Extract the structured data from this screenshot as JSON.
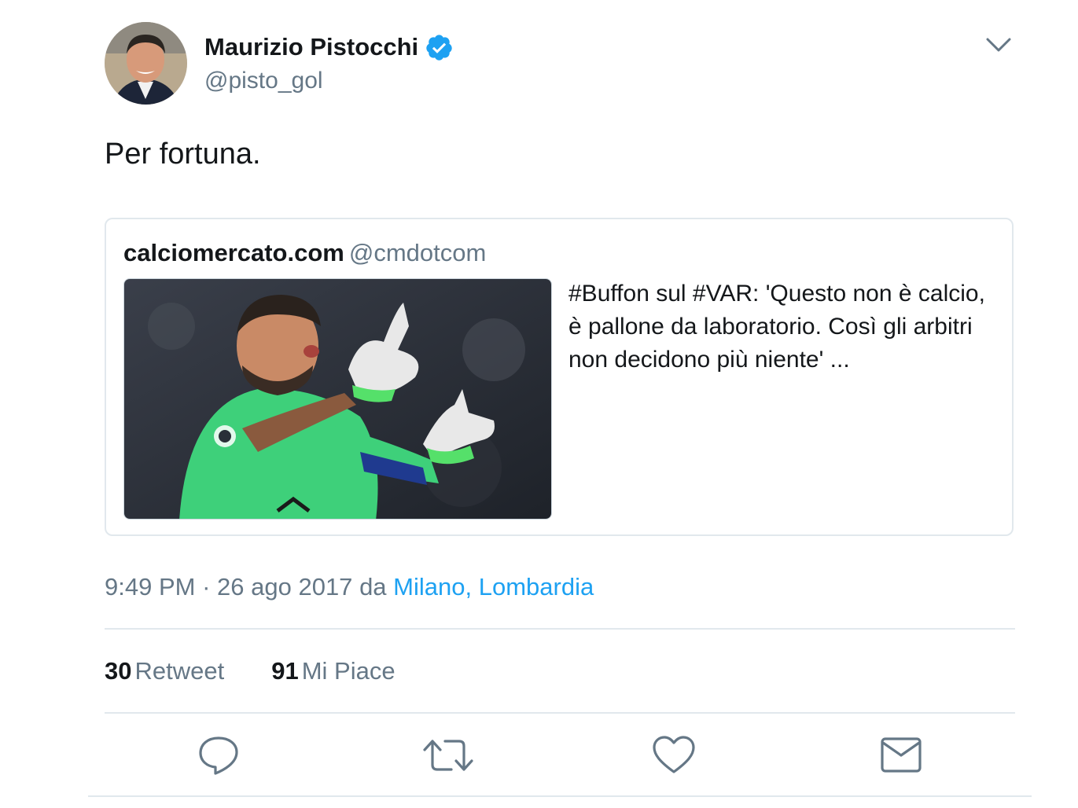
{
  "author": {
    "name": "Maurizio Pistocchi",
    "handle": "@pisto_gol",
    "verified": true
  },
  "tweet": {
    "text": "Per fortuna."
  },
  "quote": {
    "name": "calciomercato.com",
    "handle": "@cmdotcom",
    "text": "#Buffon sul #VAR: 'Questo non è calcio, è pallone da laboratorio. Così gli arbitri non decidono più niente' ..."
  },
  "meta": {
    "time": "9:49 PM",
    "separator": "·",
    "date": "26 ago 2017",
    "from_label": "da",
    "location": "Milano, Lombardia"
  },
  "stats": {
    "retweets_count": "30",
    "retweets_label": "Retweet",
    "likes_count": "91",
    "likes_label": "Mi Piace"
  },
  "actions": {
    "reply_icon": "reply-icon",
    "retweet_icon": "retweet-icon",
    "like_icon": "heart-icon",
    "message_icon": "envelope-icon"
  },
  "colors": {
    "accent": "#1da1f2",
    "secondary_text": "#657786",
    "primary_text": "#14171a",
    "border": "#e1e8ed"
  }
}
